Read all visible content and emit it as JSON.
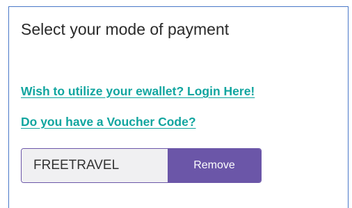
{
  "payment": {
    "title": "Select your mode of payment",
    "ewallet_link": "Wish to utilize your ewallet? Login Here!",
    "voucher_link": "Do you have a Voucher Code?",
    "voucher": {
      "value": "FREETRAVEL",
      "remove_label": "Remove"
    }
  },
  "colors": {
    "link": "#11a59f",
    "button": "#6b56a8",
    "border": "#4a78c8"
  }
}
